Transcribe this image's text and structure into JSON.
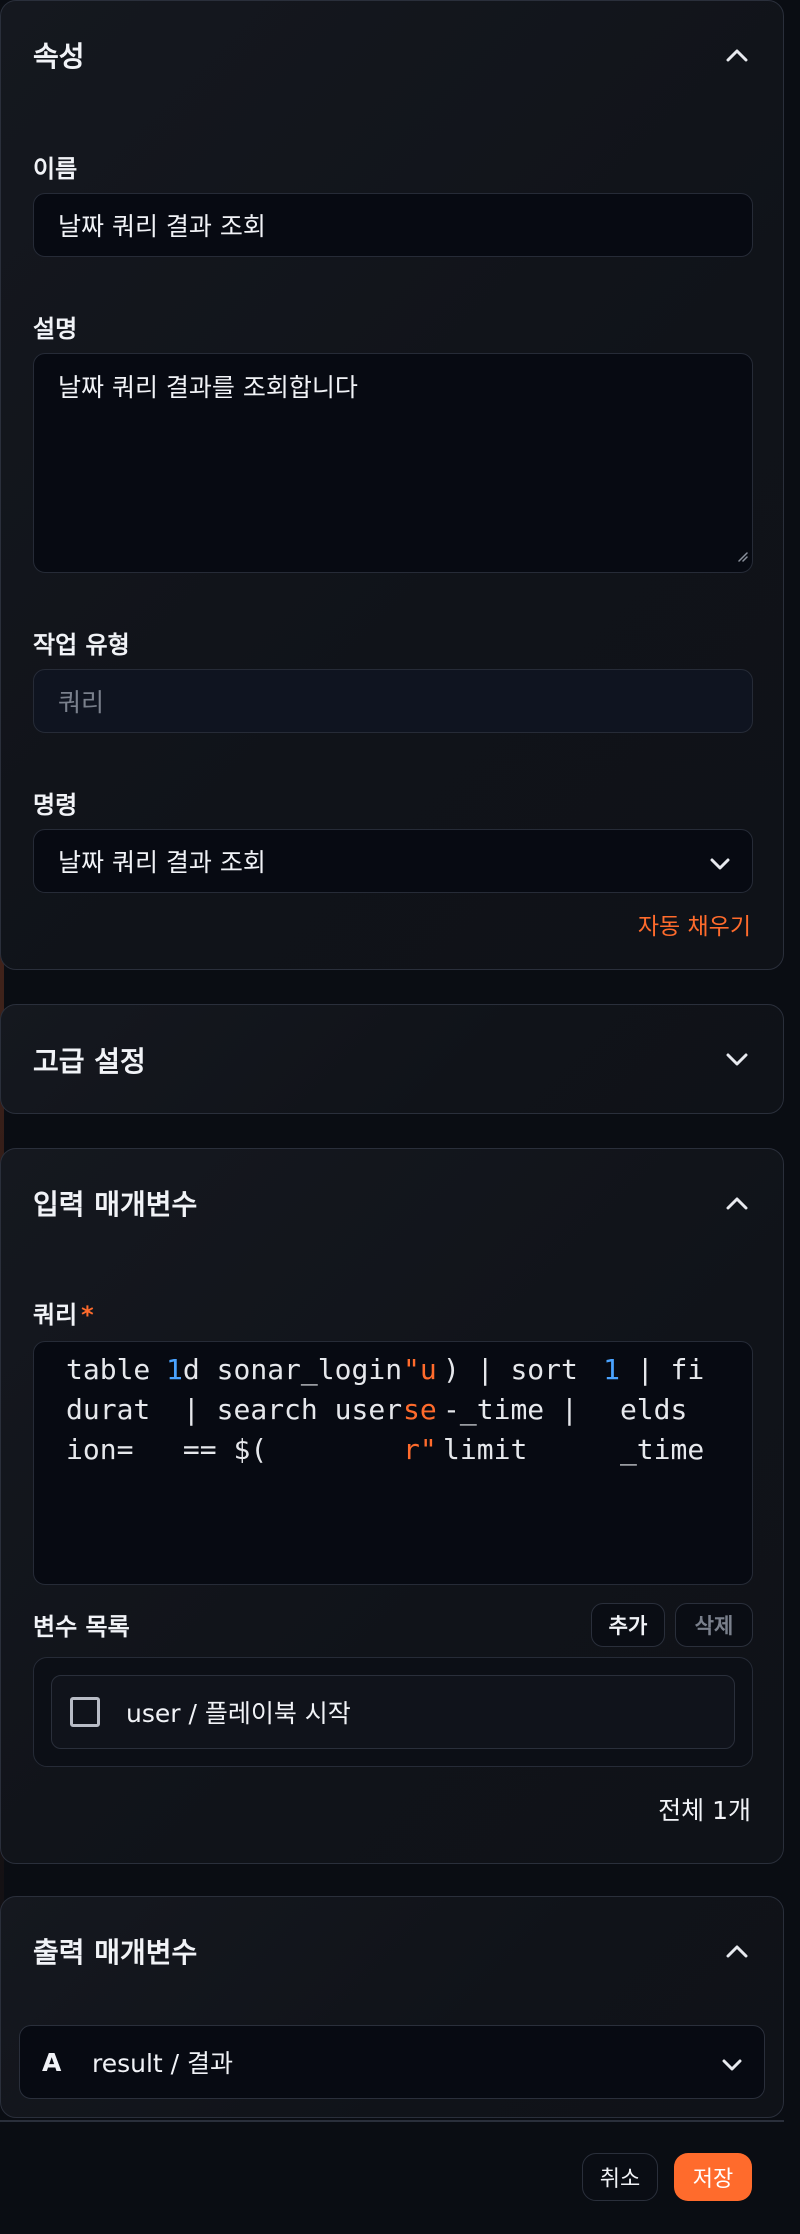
{
  "properties": {
    "title": "속성",
    "name_label": "이름",
    "name_value": "날짜 쿼리 결과 조회",
    "desc_label": "설명",
    "desc_value": "날짜 쿼리 결과를 조회합니다",
    "task_type_label": "작업 유형",
    "task_type_value": "쿼리",
    "command_label": "명령",
    "command_value": "날짜 쿼리 결과 조회",
    "autofill_label": "자동 채우기"
  },
  "advanced": {
    "title": "고급 설정"
  },
  "input_params": {
    "title": "입력 매개변수",
    "query_label": "쿼리",
    "required_mark": "*",
    "query_tokens": [
      {
        "text": "table duration=",
        "kind": "plain"
      },
      {
        "text": "1",
        "kind": "num"
      },
      {
        "text": "d sonar_login | search user == $(",
        "kind": "plain"
      },
      {
        "text": "\"user\"",
        "kind": "str"
      },
      {
        "text": ") | sort -_time | limit ",
        "kind": "plain"
      },
      {
        "text": "1",
        "kind": "num"
      },
      {
        "text": " | fields _time",
        "kind": "plain"
      }
    ],
    "var_list_label": "변수 목록",
    "add_label": "추가",
    "delete_label": "삭제",
    "variables": [
      {
        "label": "user / 플레이북 시작",
        "checked": false
      }
    ],
    "total_label": "전체 1개"
  },
  "output_params": {
    "title": "출력 매개변수",
    "type_letter": "A",
    "value": "result / 결과"
  },
  "footer": {
    "cancel_label": "취소",
    "save_label": "저장"
  },
  "colors": {
    "accent": "#ff6b2c",
    "code_number": "#4aa3ff",
    "background": "#0a0d13"
  }
}
